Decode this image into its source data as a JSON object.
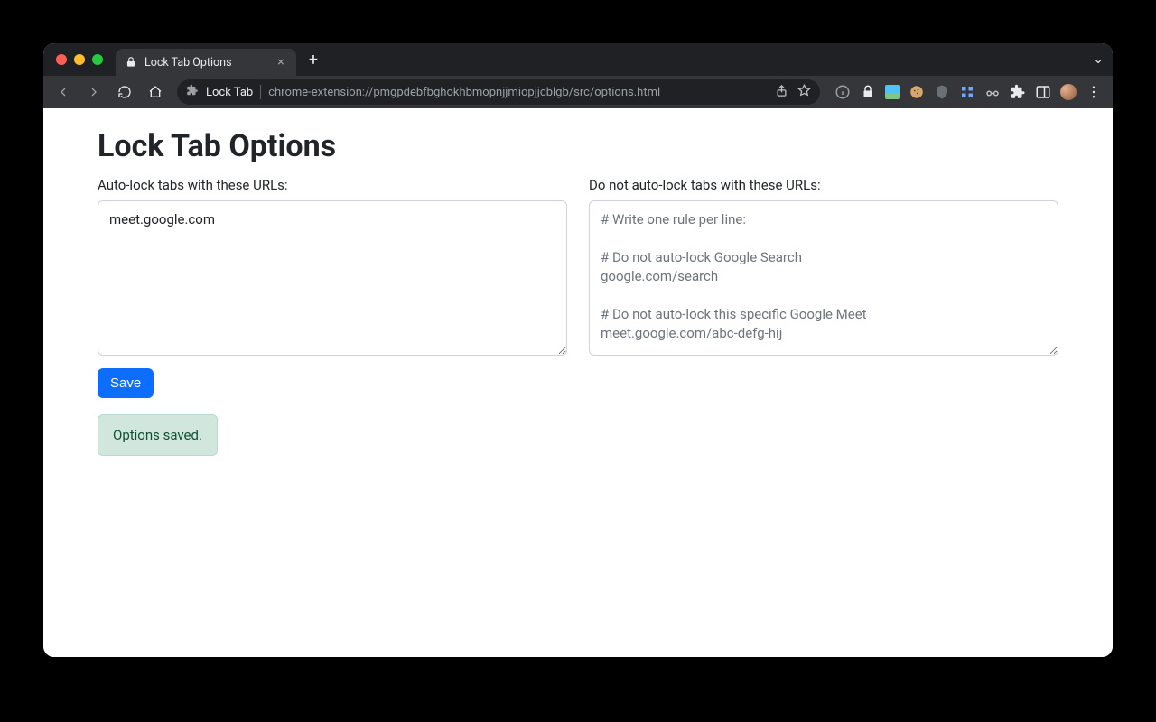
{
  "browser": {
    "tab_title": "Lock Tab Options",
    "omnibox": {
      "extension_name": "Lock Tab",
      "url": "chrome-extension://pmgpdebfbghokhbmopnjjmiopjjcblgb/src/options.html"
    }
  },
  "page": {
    "title": "Lock Tab Options",
    "autolock": {
      "label": "Auto-lock tabs with these URLs:",
      "value": "meet.google.com"
    },
    "no_autolock": {
      "label": "Do not auto-lock tabs with these URLs:",
      "value": "",
      "placeholder": "# Write one rule per line:\n\n# Do not auto-lock Google Search\ngoogle.com/search\n\n# Do not auto-lock this specific Google Meet\nmeet.google.com/abc-defg-hij"
    },
    "save_label": "Save",
    "status_message": "Options saved."
  }
}
